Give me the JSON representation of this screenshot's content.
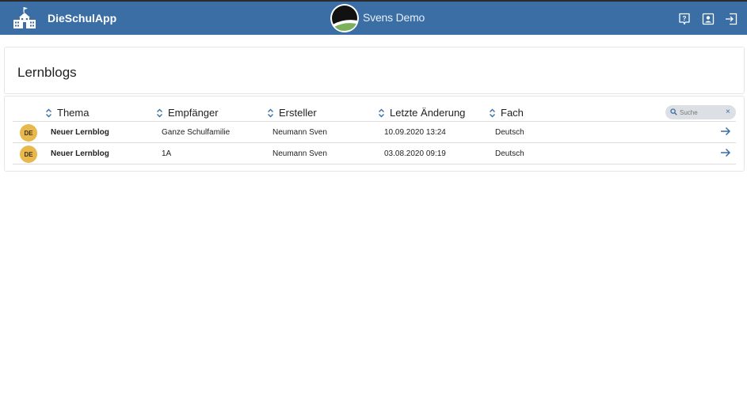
{
  "header": {
    "app_title": "DieSchulApp",
    "school_name": "Svens Demo",
    "accent": "#3a6ea5",
    "icons": [
      "school-building-icon",
      "help-icon",
      "contact-icon",
      "logout-icon"
    ]
  },
  "page": {
    "title": "Lernblogs"
  },
  "table": {
    "columns": [
      "Thema",
      "Empfänger",
      "Ersteller",
      "Letzte Änderung",
      "Fach"
    ],
    "search_placeholder": "Suche",
    "search_clear": "×",
    "rows": [
      {
        "badge": "DE",
        "thema": "Neuer Lernblog",
        "empfaenger": "Ganze Schulfamilie",
        "ersteller": "Neumann Sven",
        "datum": "10.09.2020 13:24",
        "fach": "Deutsch"
      },
      {
        "badge": "DE",
        "thema": "Neuer Lernblog",
        "empfaenger": "1A",
        "ersteller": "Neumann Sven",
        "datum": "03.08.2020 09:19",
        "fach": "Deutsch"
      }
    ]
  }
}
